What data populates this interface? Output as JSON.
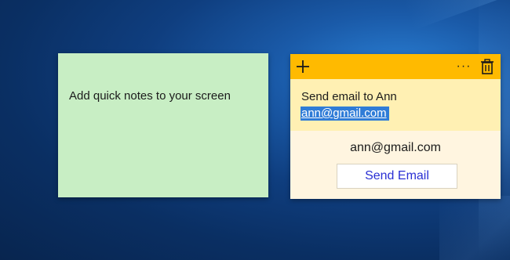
{
  "notes": {
    "green": {
      "text": "Add quick notes to your screen",
      "color": "#c8eec4"
    },
    "yellow": {
      "color": "#fff0b3",
      "toolbar_color": "#ffba00",
      "toolbar": {
        "add_icon": "plus-icon",
        "more_label": "···",
        "delete_icon": "trash-icon"
      },
      "line1": "Send email to Ann",
      "link": "ann@gmail.com",
      "action": {
        "email": "ann@gmail.com",
        "button_label": "Send Email"
      }
    }
  }
}
